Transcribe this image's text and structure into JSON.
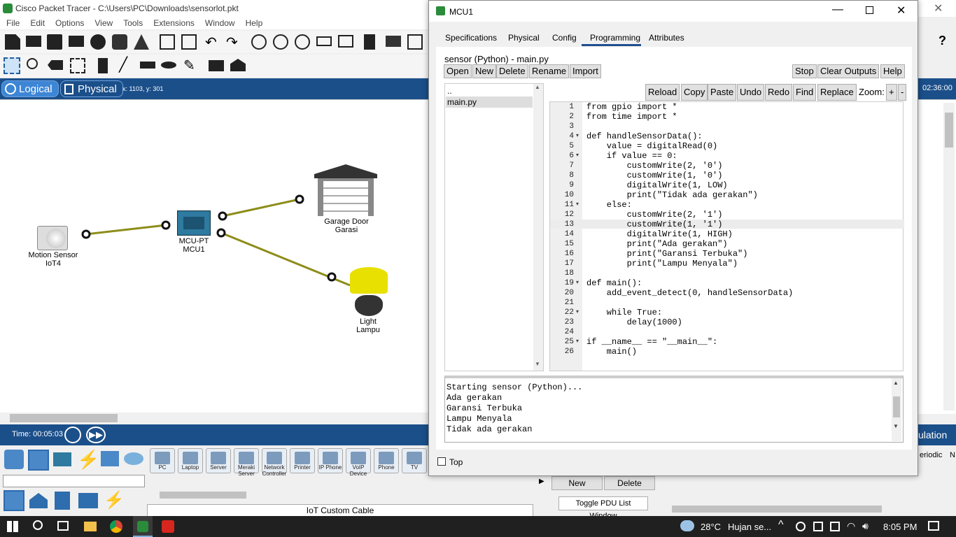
{
  "app": {
    "title": "Cisco Packet Tracer - C:\\Users\\PC\\Downloads\\sensorlot.pkt",
    "menu": [
      "File",
      "Edit",
      "Options",
      "View",
      "Tools",
      "Extensions",
      "Window",
      "Help"
    ],
    "view_logical": "Logical",
    "view_physical": "Physical",
    "coords": "x: 1103, y: 301",
    "clock": "02:36:00",
    "time_label": "Time: 00:05:03",
    "simulation_label": "ulation",
    "periodic_label": "eriodic",
    "n_label": "N",
    "pdu_new": "New",
    "pdu_delete": "Delete",
    "toggle_pdu": "Toggle PDU List Window",
    "cable_label": "IoT Custom Cable",
    "help_icon": "?"
  },
  "canvas": {
    "devices": [
      {
        "name": "Motion Sensor",
        "sub": "IoT4"
      },
      {
        "name": "MCU-PT",
        "sub": "MCU1"
      },
      {
        "name": "Garage Door",
        "sub": "Garasi"
      },
      {
        "name": "Light",
        "sub": "Lampu"
      }
    ]
  },
  "device_bar": {
    "items": [
      "PC",
      "Laptop",
      "Server",
      "Meraki Server",
      "Network Controller",
      "Printer",
      "IP Phone",
      "VoIP Device",
      "Phone",
      "TV"
    ]
  },
  "dialog": {
    "title": "MCU1",
    "tabs": [
      "Specifications",
      "Physical",
      "Config",
      "Programming",
      "Attributes"
    ],
    "active_tab": "Programming",
    "file_label": "sensor (Python) - main.py",
    "file_buttons": [
      "Open",
      "New",
      "Delete",
      "Rename",
      "Import"
    ],
    "run_buttons": [
      "Stop",
      "Clear Outputs",
      "Help"
    ],
    "edit_buttons": [
      "Reload",
      "Copy",
      "Paste",
      "Undo",
      "Redo",
      "Find",
      "Replace"
    ],
    "zoom_label": "Zoom:",
    "zoom_plus": "+",
    "zoom_minus": "-",
    "files": [
      "..",
      "main.py"
    ],
    "code_lines": [
      "from gpio import *",
      "from time import *",
      "",
      "def handleSensorData():",
      "    value = digitalRead(0)",
      "    if value == 0:",
      "        customWrite(2, '0')",
      "        customWrite(1, '0')",
      "        digitalWrite(1, LOW)",
      "        print(\"Tidak ada gerakan\")",
      "    else:",
      "        customWrite(2, '1')",
      "        customWrite(1, '1')",
      "        digitalWrite(1, HIGH)",
      "        print(\"Ada gerakan\")",
      "        print(\"Garansi Terbuka\")",
      "        print(\"Lampu Menyala\")",
      "",
      "def main():",
      "    add_event_detect(0, handleSensorData)",
      "",
      "    while True:",
      "        delay(1000)",
      "",
      "if __name__ == \"__main__\":",
      "    main()"
    ],
    "output_lines": [
      "Starting sensor (Python)...",
      "Ada gerakan",
      "Garansi Terbuka",
      "Lampu Menyala",
      "Tidak ada gerakan"
    ],
    "top_checkbox": "Top"
  },
  "taskbar": {
    "weather_temp": "28°C",
    "weather_text": "Hujan se...",
    "time": "8:05 PM"
  }
}
